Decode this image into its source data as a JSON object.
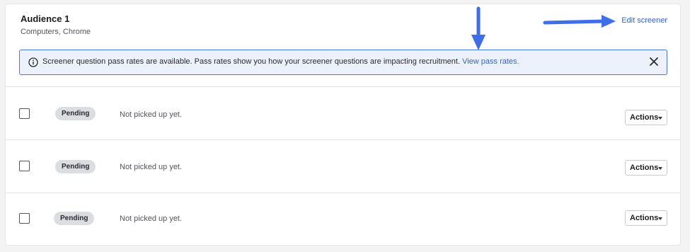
{
  "audience": {
    "title": "Audience 1",
    "subtitle": "Computers, Chrome",
    "edit_label": "Edit screener"
  },
  "banner": {
    "message": "Screener question pass rates are available. Pass rates show you how your screener questions are impacting recruitment.",
    "link_label": "View pass rates.",
    "info_icon": "info-circle-icon",
    "close_icon": "close-icon"
  },
  "rows": [
    {
      "status": "Pending",
      "detail": "Not picked up yet.",
      "actions_label": "Actions"
    },
    {
      "status": "Pending",
      "detail": "Not picked up yet.",
      "actions_label": "Actions"
    },
    {
      "status": "Pending",
      "detail": "Not picked up yet.",
      "actions_label": "Actions"
    }
  ],
  "colors": {
    "accent": "#3366cc",
    "annotation_arrow": "#3f6ee8",
    "banner_bg": "#edf1fb",
    "badge_bg": "#dcdde1"
  }
}
